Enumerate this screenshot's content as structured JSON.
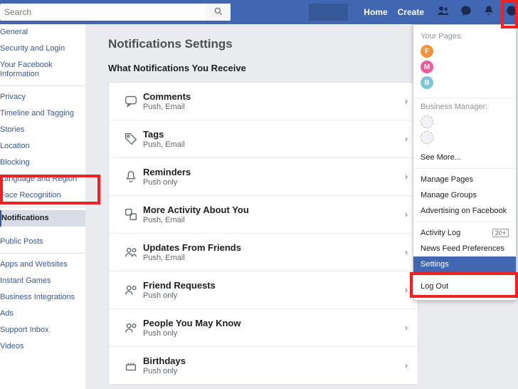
{
  "search": {
    "placeholder": "Search"
  },
  "nav": {
    "home": "Home",
    "create": "Create"
  },
  "sidebar": {
    "items": [
      "General",
      "Security and Login",
      "Your Facebook Information",
      "Privacy",
      "Timeline and Tagging",
      "Stories",
      "Location",
      "Blocking",
      "Language and Region",
      "Face Recognition",
      "Notifications",
      "",
      "Public Posts",
      "Apps and Websites",
      "Instant Games",
      "Business Integrations",
      "Ads",
      "Support Inbox",
      "Videos"
    ]
  },
  "main": {
    "title": "Notifications Settings",
    "section": "What Notifications You Receive",
    "rows": [
      {
        "title": "Comments",
        "sub": "Push, Email"
      },
      {
        "title": "Tags",
        "sub": "Push, Email"
      },
      {
        "title": "Reminders",
        "sub": "Push only"
      },
      {
        "title": "More Activity About You",
        "sub": "Push, Email"
      },
      {
        "title": "Updates From Friends",
        "sub": "Push, Email"
      },
      {
        "title": "Friend Requests",
        "sub": "Push only"
      },
      {
        "title": "People You May Know",
        "sub": "Push only"
      },
      {
        "title": "Birthdays",
        "sub": "Push only"
      }
    ]
  },
  "dropdown": {
    "yourPages": "Your Pages:",
    "pages": [
      {
        "letter": "F",
        "color": "#f7923a"
      },
      {
        "letter": "M",
        "color": "#e85d9e"
      },
      {
        "letter": "B",
        "color": "#7cc6d6"
      }
    ],
    "bm": "Business Manager:",
    "items": [
      "See More...",
      "Manage Pages",
      "Manage Groups",
      "Advertising on Facebook"
    ],
    "activity": "Activity Log",
    "activityBadge": "20+",
    "newsfeed": "News Feed Preferences",
    "settings": "Settings",
    "logout": "Log Out"
  }
}
